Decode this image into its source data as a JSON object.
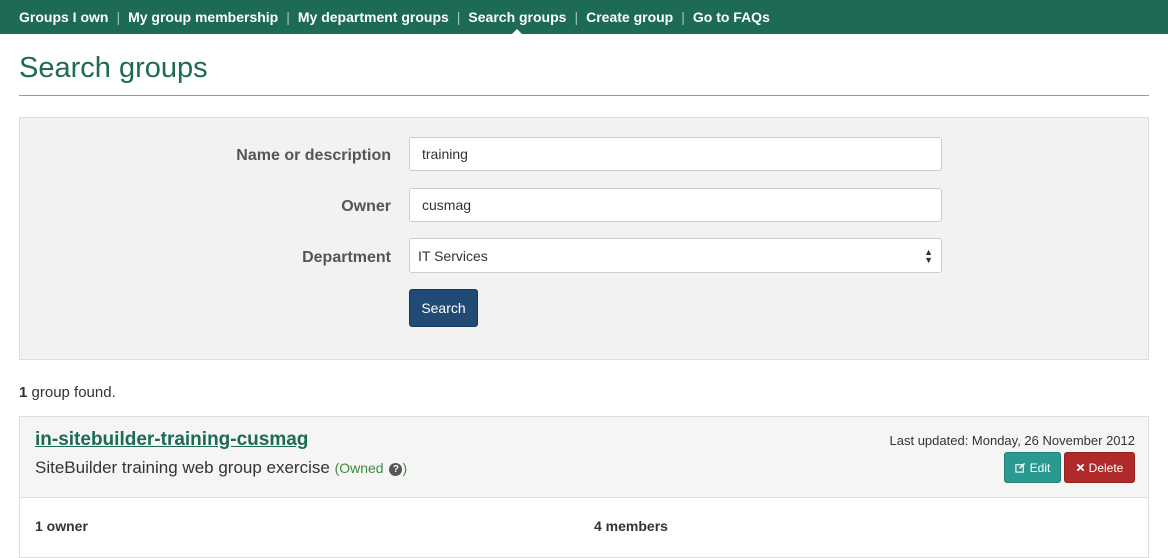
{
  "nav": {
    "items": [
      {
        "label": "Groups I own"
      },
      {
        "label": "My group membership"
      },
      {
        "label": "My department groups"
      },
      {
        "label": "Search groups"
      },
      {
        "label": "Create group"
      },
      {
        "label": "Go to FAQs"
      }
    ],
    "separator": "|"
  },
  "page": {
    "title": "Search groups"
  },
  "search": {
    "name_label": "Name or description",
    "name_value": "training",
    "owner_label": "Owner",
    "owner_value": "cusmag",
    "department_label": "Department",
    "department_value": "IT Services",
    "button_label": "Search"
  },
  "results": {
    "count": "1",
    "count_text": " group found."
  },
  "group": {
    "name": "in-sitebuilder-training-cusmag",
    "description": "SiteBuilder training web group exercise",
    "owned_open": "(Owned",
    "owned_close": ")",
    "help_icon": "?",
    "last_updated": "Last updated: Monday, 26 November 2012",
    "edit_label": "Edit",
    "delete_label": "Delete",
    "owners": "1 owner",
    "members": "4 members"
  },
  "colors": {
    "brand": "#1d6a55",
    "search_button": "#214a74",
    "edit_button": "#2a9a90",
    "delete_button": "#b02a2a"
  }
}
